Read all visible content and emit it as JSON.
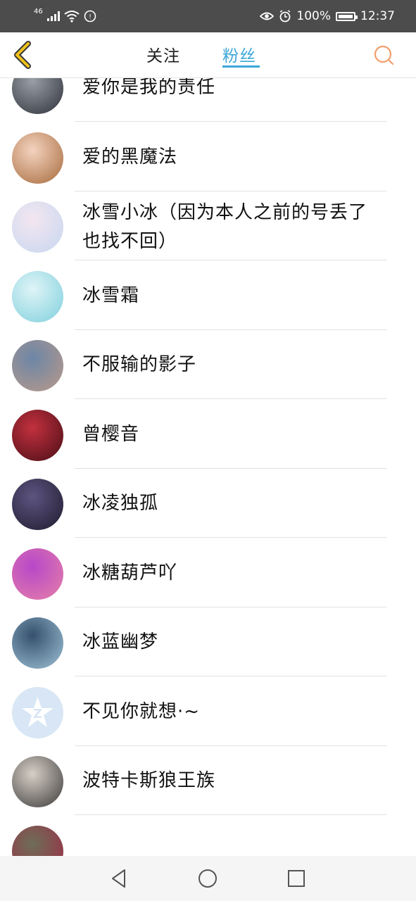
{
  "status_bar": {
    "signal_label": "46",
    "battery": "100%",
    "time": "12:37"
  },
  "header": {
    "tabs": [
      {
        "label": "关注",
        "active": false
      },
      {
        "label": "粉丝",
        "active": true
      }
    ],
    "accent_color": "#3aa7d8",
    "back_color": "#f2c21b",
    "search_color": "#f29e6c"
  },
  "fans": [
    {
      "name": "爱你是我的责任",
      "avatar_colors": [
        "#9aa0a8",
        "#2e3038"
      ]
    },
    {
      "name": "爱的黑魔法",
      "avatar_colors": [
        "#f4d3bf",
        "#a66a3c"
      ]
    },
    {
      "name": "冰雪小冰（因为本人之前的号丢了也找不回）",
      "avatar_colors": [
        "#f3e6f0",
        "#c7d7f0"
      ]
    },
    {
      "name": "冰雪霜",
      "avatar_colors": [
        "#dff4f7",
        "#7fd0dd"
      ]
    },
    {
      "name": "不服输的影子",
      "avatar_colors": [
        "#6c86a6",
        "#b9998a"
      ]
    },
    {
      "name": "曾樱音",
      "avatar_colors": [
        "#c2303e",
        "#4a0f17"
      ]
    },
    {
      "name": "冰凌独孤",
      "avatar_colors": [
        "#5d5480",
        "#1f1b2e"
      ]
    },
    {
      "name": "冰糖葫芦吖",
      "avatar_colors": [
        "#b748c8",
        "#e77fa8"
      ]
    },
    {
      "name": "冰蓝幽梦",
      "avatar_colors": [
        "#36506e",
        "#9ec3d6"
      ]
    },
    {
      "name": "不见你就想·~",
      "avatar_colors": [
        "#d8e6f5",
        "#d8e6f5"
      ]
    },
    {
      "name": "波特卡斯狼王族",
      "avatar_colors": [
        "#d7cfc6",
        "#3b3a3a"
      ]
    },
    {
      "name": "",
      "avatar_colors": [
        "#6d6e58",
        "#a02946"
      ]
    }
  ],
  "nav": {
    "back": "back-icon",
    "home": "home-icon",
    "recents": "recents-icon"
  }
}
